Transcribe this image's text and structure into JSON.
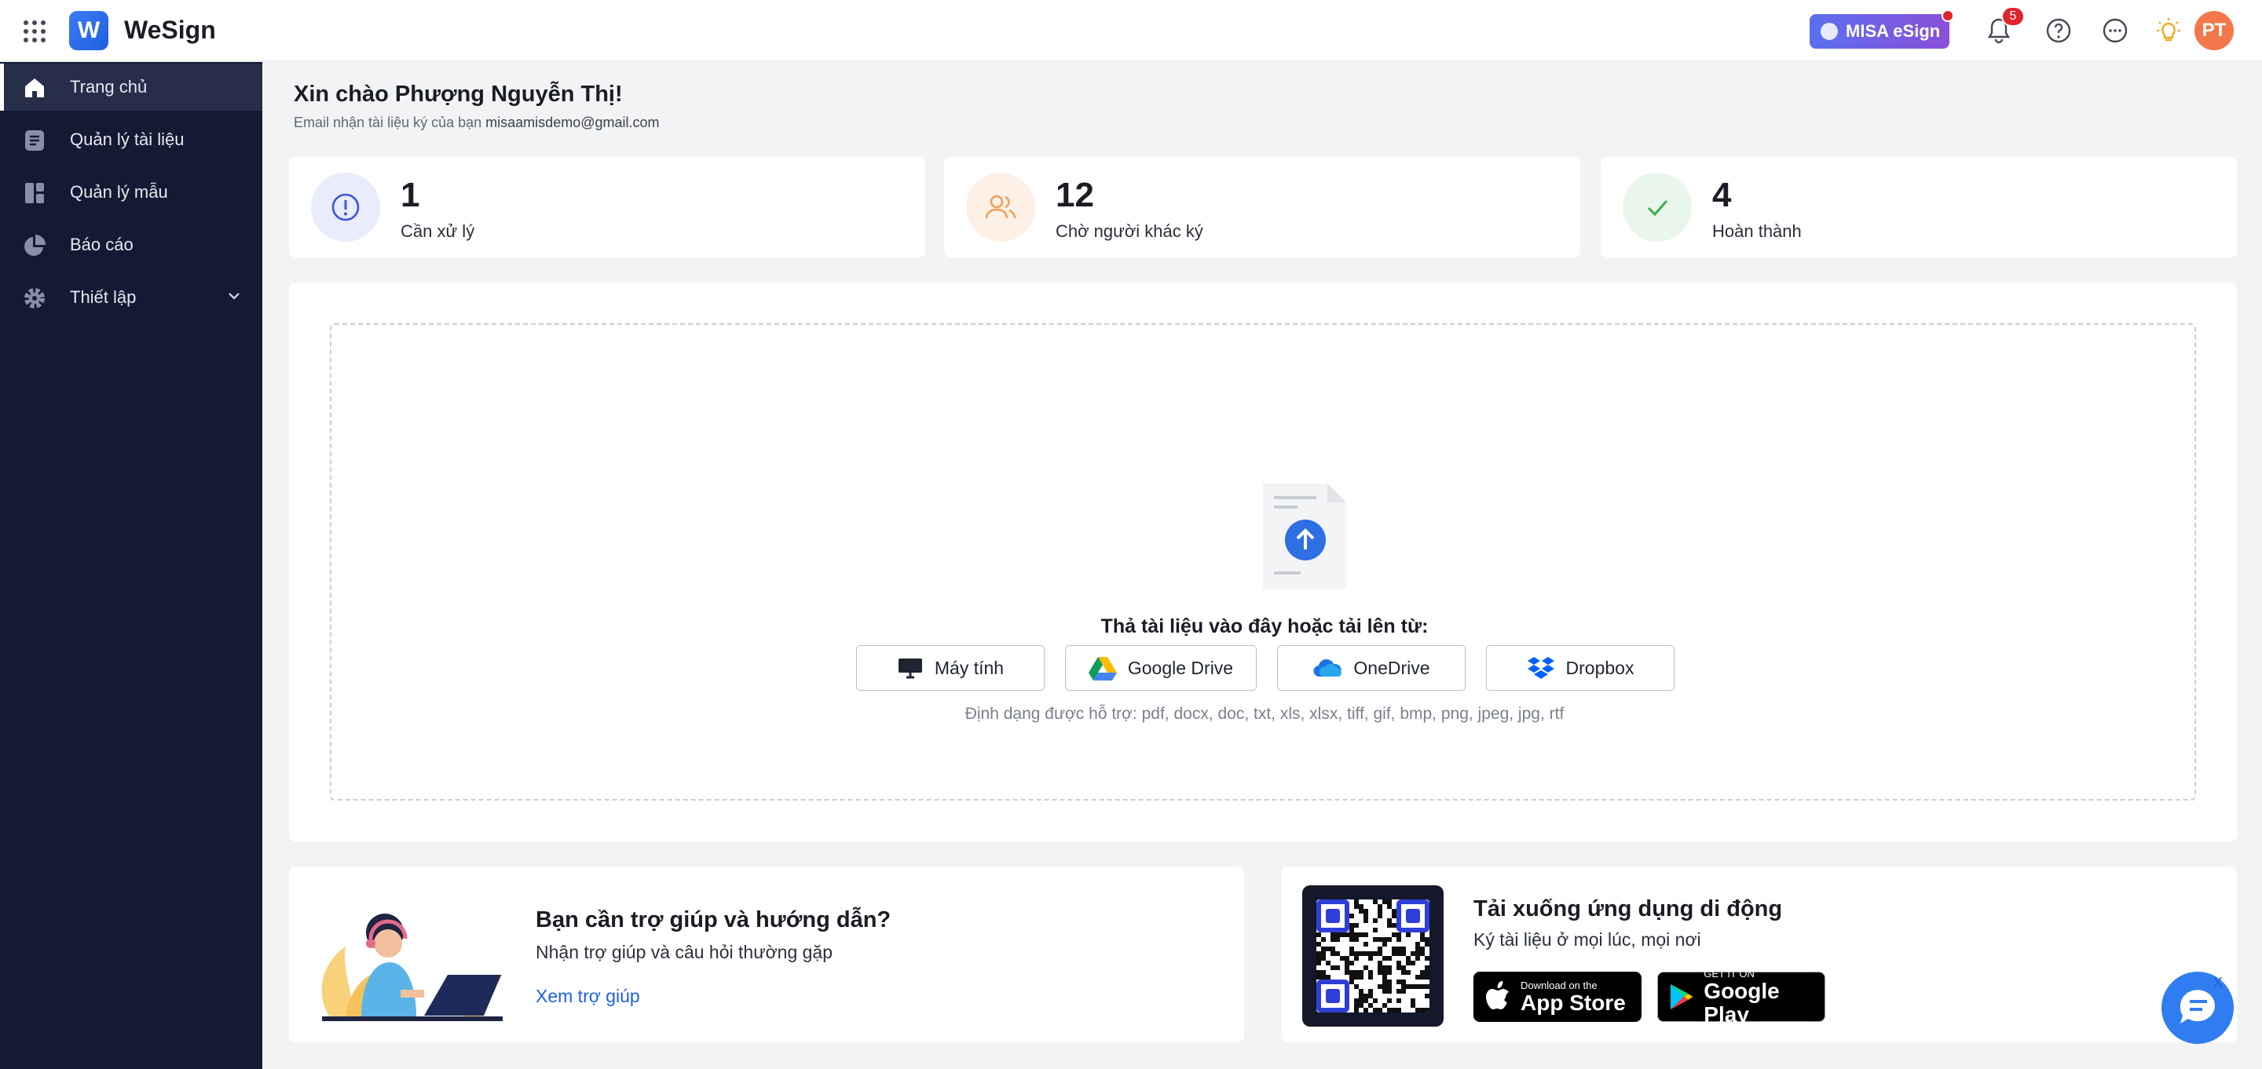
{
  "topbar": {
    "brand": "WeSign",
    "logo_letter": "W",
    "misa_badge": "MISA eSign",
    "notification_count": "5",
    "avatar_initials": "PT"
  },
  "sidebar": {
    "items": [
      {
        "label": "Trang chủ",
        "icon": "home-icon",
        "active": true
      },
      {
        "label": "Quản lý tài liệu",
        "icon": "document-list-icon"
      },
      {
        "label": "Quản lý mẫu",
        "icon": "template-icon"
      },
      {
        "label": "Báo cáo",
        "icon": "pie-chart-icon"
      },
      {
        "label": "Thiết lập",
        "icon": "gear-icon"
      }
    ]
  },
  "main": {
    "greeting": "Xin chào Phượng Nguyễn Thị!",
    "email_prefix": "Email nhận tài liệu ký của bạn",
    "email": "misaamisdemo@gmail.com",
    "stats": [
      {
        "value": "1",
        "label": "Cần xử lý",
        "color": "#3b55d9"
      },
      {
        "value": "12",
        "label": "Chờ người khác ký",
        "color": "#f0a05a"
      },
      {
        "value": "4",
        "label": "Hoàn thành",
        "color": "#3cae52"
      }
    ],
    "upload": {
      "drop_text": "Thả tài liệu vào đây hoặc tải lên từ:",
      "sources": [
        "Máy tính",
        "Google Drive",
        "OneDrive",
        "Dropbox"
      ],
      "formats": "Định dạng được hỗ trợ: pdf, docx, doc, txt, xls, xlsx, tiff, gif, bmp, png, jpeg, jpg, rtf"
    },
    "help": {
      "title": "Bạn cần trợ giúp và hướng dẫn?",
      "subtitle": "Nhận trợ giúp và câu hỏi thường gặp",
      "link": "Xem trợ giúp"
    },
    "app": {
      "title": "Tải xuống ứng dụng di động",
      "subtitle": "Ký tài liệu ở mọi lúc, mọi nơi",
      "appstore_small": "Download on the",
      "appstore_big": "App Store",
      "gplay_small": "GET IT ON",
      "gplay_big": "Google Play"
    },
    "chat_close": "X"
  }
}
